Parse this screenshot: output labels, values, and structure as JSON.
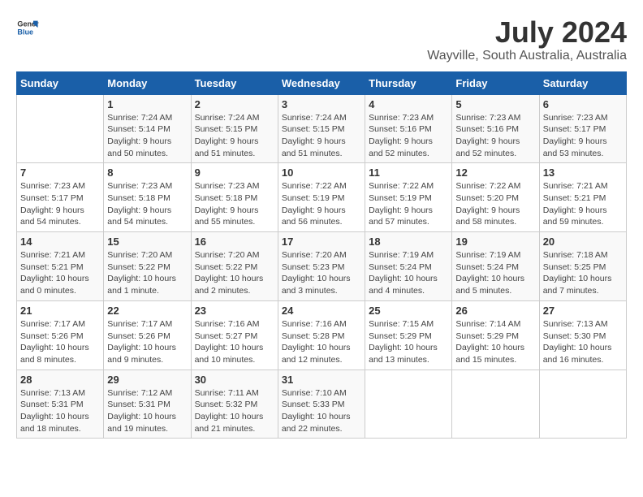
{
  "logo": {
    "general": "General",
    "blue": "Blue"
  },
  "title": "July 2024",
  "subtitle": "Wayville, South Australia, Australia",
  "days_of_week": [
    "Sunday",
    "Monday",
    "Tuesday",
    "Wednesday",
    "Thursday",
    "Friday",
    "Saturday"
  ],
  "weeks": [
    [
      {
        "day": "",
        "sunrise": "",
        "sunset": "",
        "daylight": ""
      },
      {
        "day": "1",
        "sunrise": "Sunrise: 7:24 AM",
        "sunset": "Sunset: 5:14 PM",
        "daylight": "Daylight: 9 hours and 50 minutes."
      },
      {
        "day": "2",
        "sunrise": "Sunrise: 7:24 AM",
        "sunset": "Sunset: 5:15 PM",
        "daylight": "Daylight: 9 hours and 51 minutes."
      },
      {
        "day": "3",
        "sunrise": "Sunrise: 7:24 AM",
        "sunset": "Sunset: 5:15 PM",
        "daylight": "Daylight: 9 hours and 51 minutes."
      },
      {
        "day": "4",
        "sunrise": "Sunrise: 7:23 AM",
        "sunset": "Sunset: 5:16 PM",
        "daylight": "Daylight: 9 hours and 52 minutes."
      },
      {
        "day": "5",
        "sunrise": "Sunrise: 7:23 AM",
        "sunset": "Sunset: 5:16 PM",
        "daylight": "Daylight: 9 hours and 52 minutes."
      },
      {
        "day": "6",
        "sunrise": "Sunrise: 7:23 AM",
        "sunset": "Sunset: 5:17 PM",
        "daylight": "Daylight: 9 hours and 53 minutes."
      }
    ],
    [
      {
        "day": "7",
        "sunrise": "Sunrise: 7:23 AM",
        "sunset": "Sunset: 5:17 PM",
        "daylight": "Daylight: 9 hours and 54 minutes."
      },
      {
        "day": "8",
        "sunrise": "Sunrise: 7:23 AM",
        "sunset": "Sunset: 5:18 PM",
        "daylight": "Daylight: 9 hours and 54 minutes."
      },
      {
        "day": "9",
        "sunrise": "Sunrise: 7:23 AM",
        "sunset": "Sunset: 5:18 PM",
        "daylight": "Daylight: 9 hours and 55 minutes."
      },
      {
        "day": "10",
        "sunrise": "Sunrise: 7:22 AM",
        "sunset": "Sunset: 5:19 PM",
        "daylight": "Daylight: 9 hours and 56 minutes."
      },
      {
        "day": "11",
        "sunrise": "Sunrise: 7:22 AM",
        "sunset": "Sunset: 5:19 PM",
        "daylight": "Daylight: 9 hours and 57 minutes."
      },
      {
        "day": "12",
        "sunrise": "Sunrise: 7:22 AM",
        "sunset": "Sunset: 5:20 PM",
        "daylight": "Daylight: 9 hours and 58 minutes."
      },
      {
        "day": "13",
        "sunrise": "Sunrise: 7:21 AM",
        "sunset": "Sunset: 5:21 PM",
        "daylight": "Daylight: 9 hours and 59 minutes."
      }
    ],
    [
      {
        "day": "14",
        "sunrise": "Sunrise: 7:21 AM",
        "sunset": "Sunset: 5:21 PM",
        "daylight": "Daylight: 10 hours and 0 minutes."
      },
      {
        "day": "15",
        "sunrise": "Sunrise: 7:20 AM",
        "sunset": "Sunset: 5:22 PM",
        "daylight": "Daylight: 10 hours and 1 minute."
      },
      {
        "day": "16",
        "sunrise": "Sunrise: 7:20 AM",
        "sunset": "Sunset: 5:22 PM",
        "daylight": "Daylight: 10 hours and 2 minutes."
      },
      {
        "day": "17",
        "sunrise": "Sunrise: 7:20 AM",
        "sunset": "Sunset: 5:23 PM",
        "daylight": "Daylight: 10 hours and 3 minutes."
      },
      {
        "day": "18",
        "sunrise": "Sunrise: 7:19 AM",
        "sunset": "Sunset: 5:24 PM",
        "daylight": "Daylight: 10 hours and 4 minutes."
      },
      {
        "day": "19",
        "sunrise": "Sunrise: 7:19 AM",
        "sunset": "Sunset: 5:24 PM",
        "daylight": "Daylight: 10 hours and 5 minutes."
      },
      {
        "day": "20",
        "sunrise": "Sunrise: 7:18 AM",
        "sunset": "Sunset: 5:25 PM",
        "daylight": "Daylight: 10 hours and 7 minutes."
      }
    ],
    [
      {
        "day": "21",
        "sunrise": "Sunrise: 7:17 AM",
        "sunset": "Sunset: 5:26 PM",
        "daylight": "Daylight: 10 hours and 8 minutes."
      },
      {
        "day": "22",
        "sunrise": "Sunrise: 7:17 AM",
        "sunset": "Sunset: 5:26 PM",
        "daylight": "Daylight: 10 hours and 9 minutes."
      },
      {
        "day": "23",
        "sunrise": "Sunrise: 7:16 AM",
        "sunset": "Sunset: 5:27 PM",
        "daylight": "Daylight: 10 hours and 10 minutes."
      },
      {
        "day": "24",
        "sunrise": "Sunrise: 7:16 AM",
        "sunset": "Sunset: 5:28 PM",
        "daylight": "Daylight: 10 hours and 12 minutes."
      },
      {
        "day": "25",
        "sunrise": "Sunrise: 7:15 AM",
        "sunset": "Sunset: 5:29 PM",
        "daylight": "Daylight: 10 hours and 13 minutes."
      },
      {
        "day": "26",
        "sunrise": "Sunrise: 7:14 AM",
        "sunset": "Sunset: 5:29 PM",
        "daylight": "Daylight: 10 hours and 15 minutes."
      },
      {
        "day": "27",
        "sunrise": "Sunrise: 7:13 AM",
        "sunset": "Sunset: 5:30 PM",
        "daylight": "Daylight: 10 hours and 16 minutes."
      }
    ],
    [
      {
        "day": "28",
        "sunrise": "Sunrise: 7:13 AM",
        "sunset": "Sunset: 5:31 PM",
        "daylight": "Daylight: 10 hours and 18 minutes."
      },
      {
        "day": "29",
        "sunrise": "Sunrise: 7:12 AM",
        "sunset": "Sunset: 5:31 PM",
        "daylight": "Daylight: 10 hours and 19 minutes."
      },
      {
        "day": "30",
        "sunrise": "Sunrise: 7:11 AM",
        "sunset": "Sunset: 5:32 PM",
        "daylight": "Daylight: 10 hours and 21 minutes."
      },
      {
        "day": "31",
        "sunrise": "Sunrise: 7:10 AM",
        "sunset": "Sunset: 5:33 PM",
        "daylight": "Daylight: 10 hours and 22 minutes."
      },
      {
        "day": "",
        "sunrise": "",
        "sunset": "",
        "daylight": ""
      },
      {
        "day": "",
        "sunrise": "",
        "sunset": "",
        "daylight": ""
      },
      {
        "day": "",
        "sunrise": "",
        "sunset": "",
        "daylight": ""
      }
    ]
  ]
}
